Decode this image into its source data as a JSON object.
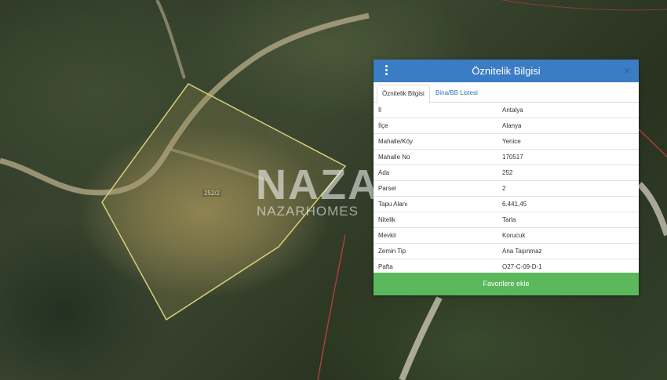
{
  "map": {
    "parcel_label": "252/2",
    "watermark_logo": "NAZA",
    "watermark_text": "NAZARHOMES"
  },
  "panel": {
    "title": "Öznitelik Bilgisi",
    "menu_icon": "vertical-ellipsis-icon",
    "close_icon": "×",
    "tabs": [
      {
        "label": "Öznitelik Bilgisi",
        "active": true
      },
      {
        "label": "Bina/BB Listesi",
        "active": false
      }
    ],
    "rows": [
      {
        "key": "İl",
        "value": "Antalya"
      },
      {
        "key": "İlçe",
        "value": "Alanya"
      },
      {
        "key": "Mahalle/Köy",
        "value": "Yenice"
      },
      {
        "key": "Mahalle No",
        "value": "170517"
      },
      {
        "key": "Ada",
        "value": "252"
      },
      {
        "key": "Parsel",
        "value": "2"
      },
      {
        "key": "Tapu Alanı",
        "value": "6.441,45"
      },
      {
        "key": "Nitelik",
        "value": "Tarla"
      },
      {
        "key": "Mevkii",
        "value": "Korucuk"
      },
      {
        "key": "Zemin Tip",
        "value": "Ana Taşınmaz"
      },
      {
        "key": "Pafta",
        "value": "O27-C-09-D-1"
      }
    ],
    "favorite_button": "Favorilere ekle"
  },
  "colors": {
    "header": "#3b7dc4",
    "button": "#5cb85c",
    "parcel_outline": "#d6cf7a",
    "boundary_red": "#b23a3a"
  }
}
